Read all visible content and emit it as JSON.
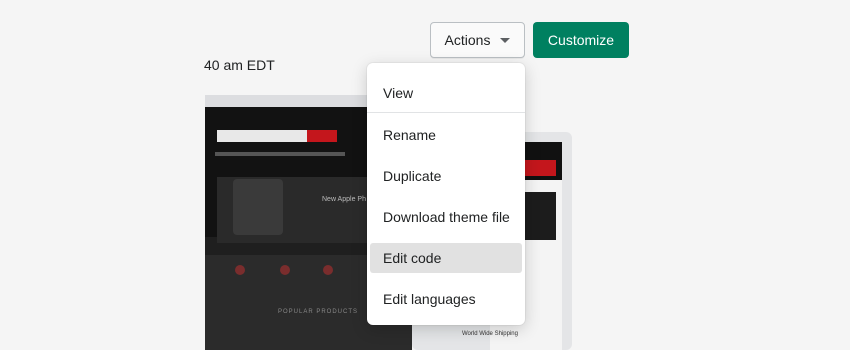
{
  "header": {
    "timestamp": "40 am EDT",
    "actions_label": "Actions",
    "customize_label": "Customize"
  },
  "menu": {
    "items": [
      {
        "label": "View"
      },
      {
        "label": "Rename"
      },
      {
        "label": "Duplicate"
      },
      {
        "label": "Download theme file"
      },
      {
        "label": "Edit code"
      },
      {
        "label": "Edit languages"
      }
    ]
  },
  "preview": {
    "banner_text": "New Apple Ph",
    "popular_label": "POPULAR PRODUCTS",
    "shipping_label": "World Wide Shipping"
  },
  "colors": {
    "primary": "#008060",
    "accent": "#c4161c"
  }
}
